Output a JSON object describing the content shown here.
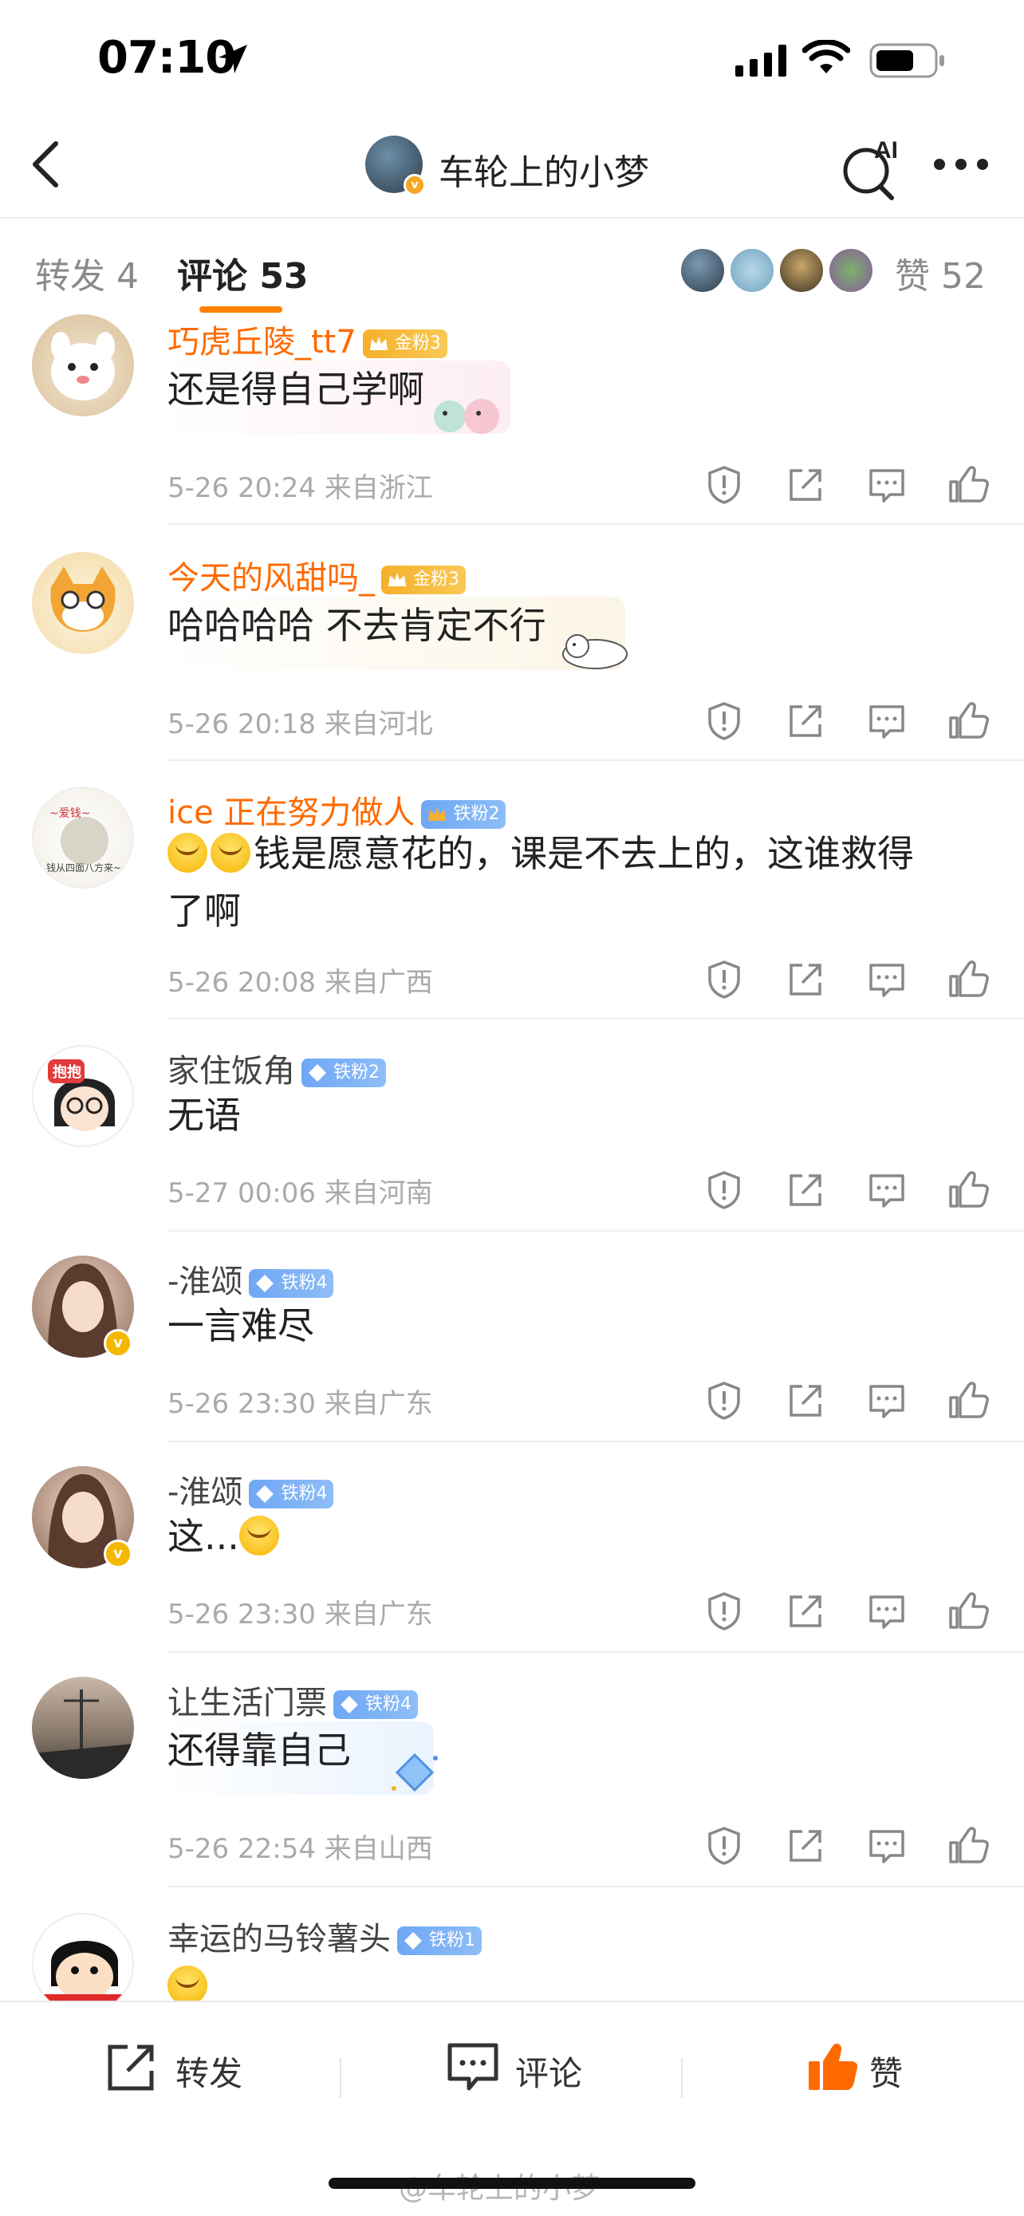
{
  "status_bar": {
    "time": "07:10"
  },
  "nav": {
    "title": "车轮上的小梦"
  },
  "tabs": {
    "repost": "转发 4",
    "comment": "评论 53",
    "like": "赞 52"
  },
  "comments": [
    {
      "user": "巧虎丘陵_tt7",
      "badge": "金粉3",
      "text": "还是得自己学啊",
      "meta": "5-26 20:24 来自浙江"
    },
    {
      "user": "今天的风甜吗_",
      "badge": "金粉3",
      "text": "哈哈哈哈 不去肯定不行",
      "meta": "5-26 20:18 来自河北"
    },
    {
      "user": "ice 正在努力做人",
      "badge": "铁粉2",
      "text": "钱是愿意花的，课是不去上的，这谁救得",
      "text2": "了啊",
      "meta": "5-26 20:08 来自广西"
    },
    {
      "user": "家住饭角",
      "badge": "铁粉2",
      "text": "无语",
      "meta": "5-27 00:06 来自河南"
    },
    {
      "user": "-淮颂",
      "badge": "铁粉4",
      "text": "一言难尽",
      "meta": "5-26 23:30 来自广东"
    },
    {
      "user": "-淮颂",
      "badge": "铁粉4",
      "text": "这...",
      "meta": "5-26 23:30 来自广东"
    },
    {
      "user": "让生活门票",
      "badge": "铁粉4",
      "text": "还得靠自己",
      "meta": "5-26 22:54 来自山西"
    },
    {
      "user": "幸运的马铃薯头",
      "badge": "铁粉1",
      "text": "",
      "meta": ""
    }
  ],
  "bottom_bar": {
    "repost": "转发",
    "comment": "评论",
    "like": "赞"
  },
  "watermark": "@车轮上的小梦",
  "colors": {
    "accent": "#ff8200",
    "username_vip": "#ff6a00",
    "gold_badge": "#f6b02b",
    "iron_badge": "#6fa7f5",
    "like_active": "#ff6a00"
  }
}
